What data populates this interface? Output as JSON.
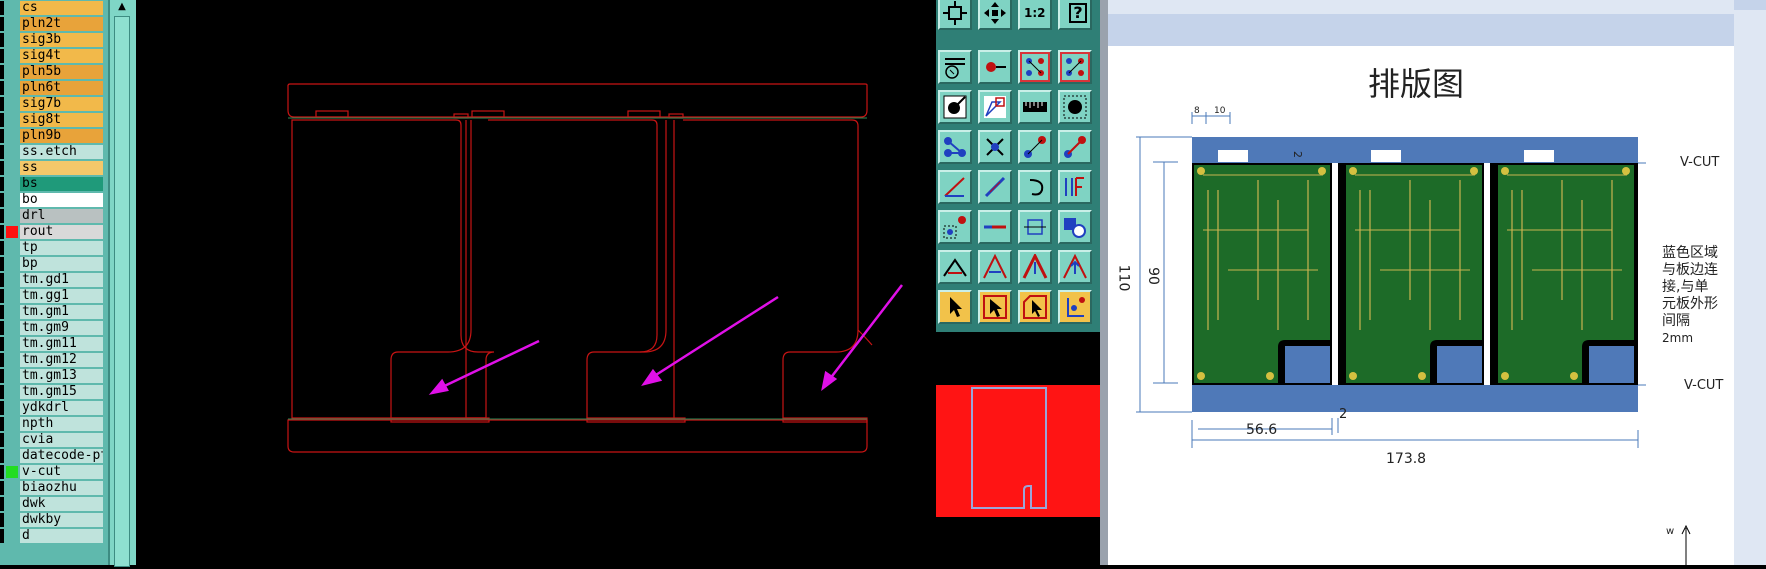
{
  "layers": [
    {
      "name": "cs",
      "bg": "#f2b94a",
      "swatch": null
    },
    {
      "name": "pln2t",
      "bg": "#e8a33a",
      "swatch": null
    },
    {
      "name": "sig3b",
      "bg": "#f2b94a",
      "swatch": null
    },
    {
      "name": "sig4t",
      "bg": "#f2b94a",
      "swatch": null
    },
    {
      "name": "pln5b",
      "bg": "#e8a33a",
      "swatch": null
    },
    {
      "name": "pln6t",
      "bg": "#e8a33a",
      "swatch": null
    },
    {
      "name": "sig7b",
      "bg": "#f2b94a",
      "swatch": null
    },
    {
      "name": "sig8t",
      "bg": "#f2b94a",
      "swatch": null
    },
    {
      "name": "pln9b",
      "bg": "#e8a33a",
      "swatch": null
    },
    {
      "name": "ss.etch",
      "bg": "#bfe3dc",
      "swatch": null
    },
    {
      "name": "ss",
      "bg": "#f4c86a",
      "swatch": null
    },
    {
      "name": "bs",
      "bg": "#1f9a7a",
      "swatch": null
    },
    {
      "name": "bo",
      "bg": "#ffffff",
      "swatch": null
    },
    {
      "name": "drl",
      "bg": "#b9c1c1",
      "swatch": null
    },
    {
      "name": "rout",
      "bg": "#d9d9d9",
      "swatch": "#ff1010"
    },
    {
      "name": "tp",
      "bg": "#bfe3dc",
      "swatch": null
    },
    {
      "name": "bp",
      "bg": "#bfe3dc",
      "swatch": null
    },
    {
      "name": "tm.gd1",
      "bg": "#bfe3dc",
      "swatch": null
    },
    {
      "name": "tm.gg1",
      "bg": "#bfe3dc",
      "swatch": null
    },
    {
      "name": "tm.gm1",
      "bg": "#bfe3dc",
      "swatch": null
    },
    {
      "name": "tm.gm9",
      "bg": "#bfe3dc",
      "swatch": null
    },
    {
      "name": "tm.gm11",
      "bg": "#bfe3dc",
      "swatch": null
    },
    {
      "name": "tm.gm12",
      "bg": "#bfe3dc",
      "swatch": null
    },
    {
      "name": "tm.gm13",
      "bg": "#bfe3dc",
      "swatch": null
    },
    {
      "name": "tm.gm15",
      "bg": "#bfe3dc",
      "swatch": null
    },
    {
      "name": "ydkdrl",
      "bg": "#bfe3dc",
      "swatch": null
    },
    {
      "name": "npth",
      "bg": "#bfe3dc",
      "swatch": null
    },
    {
      "name": "cvia",
      "bg": "#bfe3dc",
      "swatch": null
    },
    {
      "name": "datecode-pto",
      "bg": "#bfe3dc",
      "swatch": null
    },
    {
      "name": "v-cut",
      "bg": "#bfe3dc",
      "swatch": "#22dd22"
    },
    {
      "name": "biaozhu",
      "bg": "#bfe3dc",
      "swatch": null
    },
    {
      "name": "dwk",
      "bg": "#bfe3dc",
      "swatch": null
    },
    {
      "name": "dwkby",
      "bg": "#bfe3dc",
      "swatch": null
    },
    {
      "name": "d",
      "bg": "#bfe3dc",
      "swatch": null
    }
  ],
  "toolbar": {
    "zoom_ratio_label": "1:2",
    "help_label": "?"
  },
  "document": {
    "title": "排版图",
    "dim_8": "8",
    "dim_10": "10",
    "dim_2_top": "2",
    "dim_110": "110",
    "dim_90": "90",
    "dim_56_6": "56.6",
    "dim_2_bottom": "2",
    "dim_173_8": "173.8",
    "vcut_top": "V-CUT",
    "vcut_bottom": "V-CUT",
    "note_line1": "蓝色区域",
    "note_line2": "与板边连",
    "note_line3": "接,与单",
    "note_line4": "元板外形",
    "note_line5": "间隔",
    "note_line6": "2mm",
    "arrow_label": "w"
  },
  "colors": {
    "outline": "#c81414",
    "vcut_line": "#2e8b57",
    "arrow": "#e010e8",
    "panel_blue": "#4f79b8",
    "pcb_green": "#1d6b28"
  }
}
